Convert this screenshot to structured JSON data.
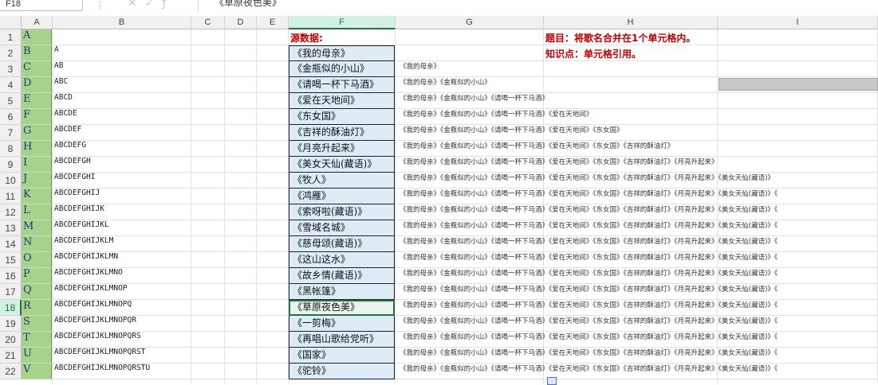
{
  "formula_bar": {
    "name_box": "F18",
    "separator": "⋮",
    "icons": [
      "cancel-icon",
      "confirm-icon",
      "function-icon"
    ],
    "content": "《草原夜色美》"
  },
  "columns": [
    "A",
    "B",
    "C",
    "D",
    "E",
    "F",
    "G",
    "H",
    "I"
  ],
  "selected_column": "F",
  "selected_row": 18,
  "rows": [
    1,
    2,
    3,
    4,
    5,
    6,
    7,
    8,
    9,
    10,
    11,
    12,
    13,
    14,
    15,
    16,
    17,
    18,
    19,
    20,
    21,
    22
  ],
  "colA": [
    "A",
    "B",
    "C",
    "D",
    "E",
    "F",
    "G",
    "H",
    "I",
    "J",
    "K",
    "L",
    "M",
    "N",
    "O",
    "P",
    "Q",
    "R",
    "S",
    "T",
    "U",
    "V"
  ],
  "colB": [
    "",
    "A",
    "AB",
    "ABC",
    "ABCD",
    "ABCDE",
    "ABCDEF",
    "ABCDEFG",
    "ABCDEFGH",
    "ABCDEFGHI",
    "ABCDEFGHIJ",
    "ABCDEFGHIJK",
    "ABCDEFGHIJKL",
    "ABCDEFGHIJKLM",
    "ABCDEFGHIJKLMN",
    "ABCDEFGHIJKLMNO",
    "ABCDEFGHIJKLMNOP",
    "ABCDEFGHIJKLMNOPQ",
    "ABCDEFGHIJKLMNOPQR",
    "ABCDEFGHIJKLMNOPQRS",
    "ABCDEFGHIJKLMNOPQRST",
    "ABCDEFGHIJKLMNOPQRSTU"
  ],
  "f_header": "源数据:",
  "songs": [
    "《我的母亲》",
    "《金瓶似的小山》",
    "《请喝一杯下马酒》",
    "《爱在天地间》",
    "《东女国》",
    "《吉祥的酥油灯》",
    "《月亮升起来》",
    "《美女天仙(藏语)》",
    "《牧人》",
    "《鸿雁》",
    "《索呀啦(藏语)》",
    "《雪域名城》",
    "《慈母颂(藏语)》",
    "《这山这水》",
    "《故乡情(藏语)》",
    "《黑帐篷》",
    "《草原夜色美》",
    "《一剪梅》",
    "《再唱山歌给党听》",
    "《国家》",
    "《驼铃》"
  ],
  "colG": [
    "",
    "",
    "《我的母亲》",
    "《我的母亲》《金瓶似的小山》",
    "《我的母亲》《金瓶似的小山》《请喝一杯下马酒》",
    "《我的母亲》《金瓶似的小山》《请喝一杯下马酒》《爱在天地间》",
    "《我的母亲》《金瓶似的小山》《请喝一杯下马酒》《爱在天地间》《东女国》",
    "《我的母亲》《金瓶似的小山》《请喝一杯下马酒》《爱在天地间》《东女国》《吉祥的酥油灯》",
    "《我的母亲》《金瓶似的小山》《请喝一杯下马酒》《爱在天地间》《东女国》《吉祥的酥油灯》《月亮升起来》",
    "《我的母亲》《金瓶似的小山》《请喝一杯下马酒》《爱在天地间》《东女国》《吉祥的酥油灯》《月亮升起来》《美女天仙(藏语)》",
    "《我的母亲》《金瓶似的小山》《请喝一杯下马酒》《爱在天地间》《东女国》《吉祥的酥油灯》《月亮升起来》《美女天仙(藏语)》《",
    "《我的母亲》《金瓶似的小山》《请喝一杯下马酒》《爱在天地间》《东女国》《吉祥的酥油灯》《月亮升起来》《美女天仙(藏语)》《",
    "《我的母亲》《金瓶似的小山》《请喝一杯下马酒》《爱在天地间》《东女国》《吉祥的酥油灯》《月亮升起来》《美女天仙(藏语)》《",
    "《我的母亲》《金瓶似的小山》《请喝一杯下马酒》《爱在天地间》《东女国》《吉祥的酥油灯》《月亮升起来》《美女天仙(藏语)》《",
    "《我的母亲》《金瓶似的小山》《请喝一杯下马酒》《爱在天地间》《东女国》《吉祥的酥油灯》《月亮升起来》《美女天仙(藏语)》《",
    "《我的母亲》《金瓶似的小山》《请喝一杯下马酒》《爱在天地间》《东女国》《吉祥的酥油灯》《月亮升起来》《美女天仙(藏语)》《",
    "《我的母亲》《金瓶似的小山》《请喝一杯下马酒》《爱在天地间》《东女国》《吉祥的酥油灯》《月亮升起来》《美女天仙(藏语)》《",
    "《我的母亲》《金瓶似的小山》《请喝一杯下马酒》《爱在天地间》《东女国》《吉祥的酥油灯》《月亮升起来》《美女天仙(藏语)》《",
    "《我的母亲》《金瓶似的小山》《请喝一杯下马酒》《爱在天地间》《东女国》《吉祥的酥油灯》《月亮升起来》《美女天仙(藏语)》《",
    "《我的母亲》《金瓶似的小山》《请喝一杯下马酒》《爱在天地间》《东女国》《吉祥的酥油灯》《月亮升起来》《美女天仙(藏语)》《",
    "《我的母亲》《金瓶似的小山》《请喝一杯下马酒》《爱在天地间》《东女国》《吉祥的酥油灯》《月亮升起来》《美女天仙(藏语)》《",
    "《我的母亲》《金瓶似的小山》《请喝一杯下马酒》《爱在天地间》《东女国》《吉祥的酥油灯》《月亮升起来》《美女天仙(藏语)》《"
  ],
  "notes": {
    "title": "题目：将歌名合并在1个单元格内。",
    "knowledge": "知识点：单元格引用。"
  },
  "colors": {
    "header_green": "#217346",
    "colA_fill": "#a9d18e",
    "colF_fill": "#ddebf7",
    "note_red": "#c00000"
  }
}
